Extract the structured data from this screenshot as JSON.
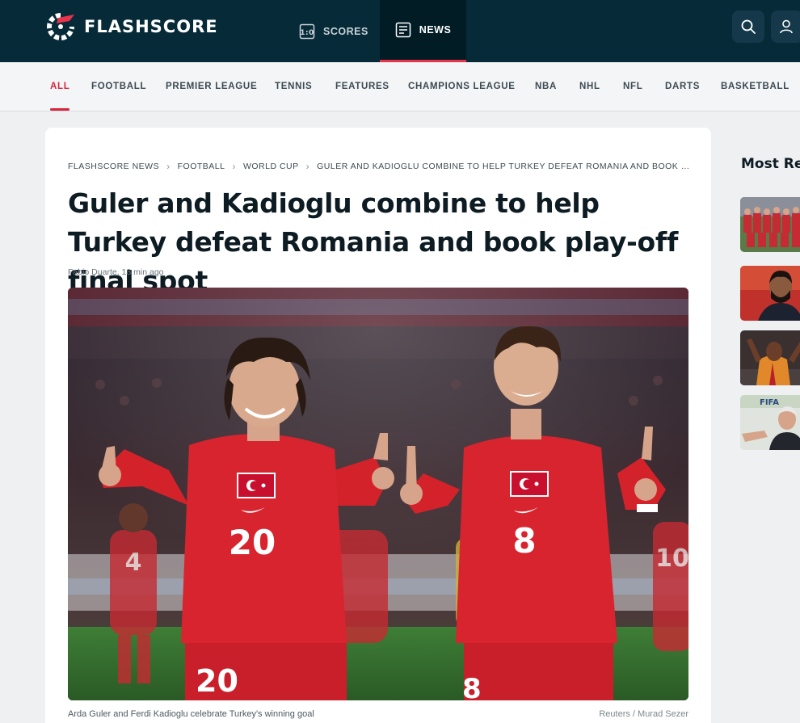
{
  "header": {
    "logo_text": "FLASHSCORE",
    "nav": [
      {
        "label": "SCORES",
        "icon": "scoreboard-icon"
      },
      {
        "label": "NEWS",
        "icon": "newspaper-icon",
        "active": true
      }
    ],
    "search_icon": "search-icon",
    "user_icon": "user-icon"
  },
  "categories": [
    {
      "label": "ALL",
      "active": true
    },
    {
      "label": "FOOTBALL"
    },
    {
      "label": "PREMIER LEAGUE"
    },
    {
      "label": "TENNIS"
    },
    {
      "label": "FEATURES"
    },
    {
      "label": "CHAMPIONS LEAGUE"
    },
    {
      "label": "NBA"
    },
    {
      "label": "NHL"
    },
    {
      "label": "NFL"
    },
    {
      "label": "DARTS"
    },
    {
      "label": "BASKETBALL"
    }
  ],
  "article": {
    "breadcrumbs": [
      "FLASHSCORE NEWS",
      "FOOTBALL",
      "WORLD CUP",
      "GULER AND KADIOGLU COMBINE TO HELP TURKEY DEFEAT ROMANIA AND BOOK PLAY-OFF FINAL SPOT"
    ],
    "headline": "Guler and Kadioglu combine to help Turkey defeat Romania and book play-off final spot",
    "author": "Fabio Duarte",
    "time_ago": "18 min ago",
    "image": {
      "player_left_number": "20",
      "player_right_number": "8",
      "shorts_left_number": "20",
      "shorts_right_number": "8",
      "background_player_number": "4",
      "background_player_number_right": "10"
    },
    "caption": "Arda Guler and Ferdi Kadioglu celebrate Turkey's winning goal",
    "credit": "Reuters / Murad Sezer"
  },
  "sidebar": {
    "title": "Most Re",
    "thumbnails": [
      {
        "name": "team-photo-thumbnail",
        "badge": ""
      },
      {
        "name": "player-portrait-thumbnail",
        "badge": ""
      },
      {
        "name": "celebration-thumbnail",
        "badge": ""
      },
      {
        "name": "press-conference-thumbnail",
        "badge": "FIFA"
      }
    ]
  },
  "colors": {
    "header_bg": "#062a38",
    "accent": "#e8334a",
    "turkey_red": "#d8242f",
    "pitch_green": "#3d7a35"
  }
}
